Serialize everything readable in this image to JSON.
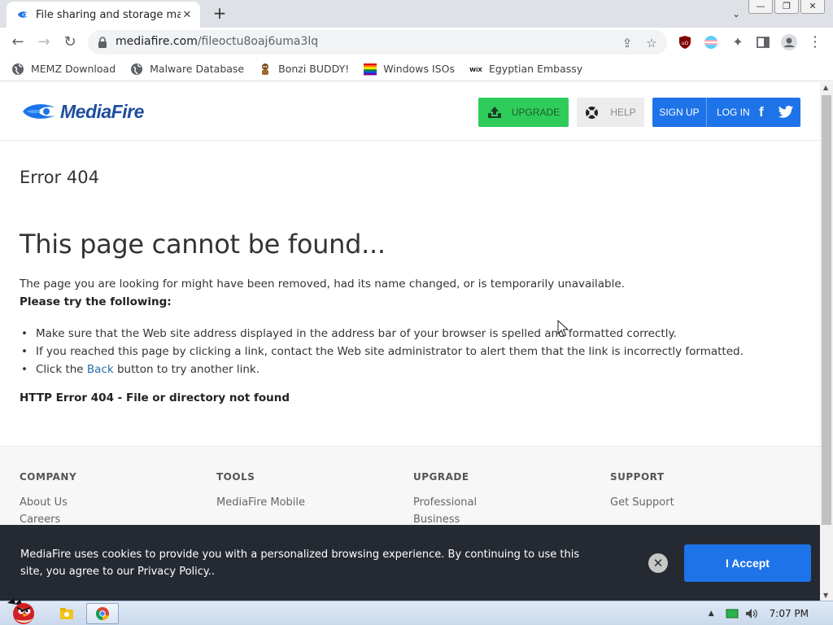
{
  "browser": {
    "tab_title": "File sharing and storage made simple",
    "tab_close": "✕",
    "new_tab": "+",
    "tab_search": "⌄",
    "window_buttons": {
      "minimize": "—",
      "restore": "❐",
      "close": "✕"
    },
    "url_host": "mediafire.com",
    "url_path": "/fileoctu8oaj6uma3lq",
    "bookmarks": [
      {
        "label": "MEMZ Download",
        "icon": "globe-icon"
      },
      {
        "label": "Malware Database",
        "icon": "globe-icon"
      },
      {
        "label": "Bonzi BUDDY!",
        "icon": "bonzi-icon"
      },
      {
        "label": "Windows ISOs",
        "icon": "rainbow-flag-icon"
      },
      {
        "label": "Egyptian Embassy",
        "icon": "wix-icon"
      }
    ]
  },
  "site": {
    "logo_text": "MediaFire",
    "upgrade_label": "UPGRADE",
    "help_label": "HELP",
    "signup_label": "SIGN UP",
    "login_label": "LOG IN",
    "facebook_letter": "f"
  },
  "error": {
    "code": "Error 404",
    "title": "This page cannot be found...",
    "description": "The page you are looking for might have been removed, had its name changed, or is temporarily unavailable.",
    "try_heading": "Please try the following:",
    "tips": [
      "Make sure that the Web site address displayed in the address bar of your browser is spelled and formatted correctly.",
      "If you reached this page by clicking a link, contact the Web site administrator to alert them that the link is incorrectly formatted."
    ],
    "back_prefix": "Click the ",
    "back_link": "Back",
    "back_suffix": " button to try another link.",
    "http_line": "HTTP Error 404 - File or directory not found"
  },
  "footer": {
    "columns": [
      {
        "heading": "COMPANY",
        "links": [
          "About Us",
          "Careers"
        ]
      },
      {
        "heading": "TOOLS",
        "links": [
          "MediaFire Mobile"
        ]
      },
      {
        "heading": "UPGRADE",
        "links": [
          "Professional",
          "Business"
        ]
      },
      {
        "heading": "SUPPORT",
        "links": [
          "Get Support"
        ]
      }
    ]
  },
  "cookie": {
    "text": "MediaFire uses cookies to provide you with a personalized browsing experience. By continuing to use this site, you agree to our Privacy Policy..",
    "close": "✕",
    "accept_label": "I Accept"
  },
  "taskbar": {
    "clock": "7:07 PM"
  },
  "colors": {
    "brand_blue": "#1e73e8",
    "upgrade_green": "#2ecc5b",
    "cookie_bg": "#252a32"
  }
}
